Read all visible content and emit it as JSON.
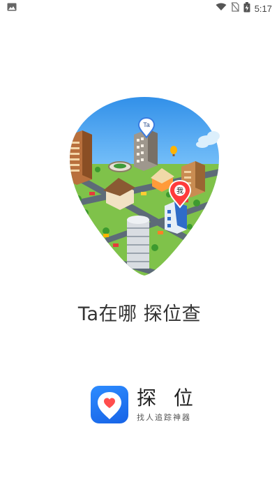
{
  "status_bar": {
    "time": "5:17",
    "icons": [
      "image-notification-icon",
      "wifi-icon",
      "no-sim-icon",
      "battery-charging-icon"
    ]
  },
  "illustration": {
    "pin_labels": {
      "ta": "Ta",
      "me": "我"
    }
  },
  "slogan": "Ta在哪 探位查",
  "brand": {
    "name": "探 位",
    "tagline": "找人追踪神器",
    "icon_color": "#1f77f5",
    "heart_color": "#ff4d4d"
  }
}
